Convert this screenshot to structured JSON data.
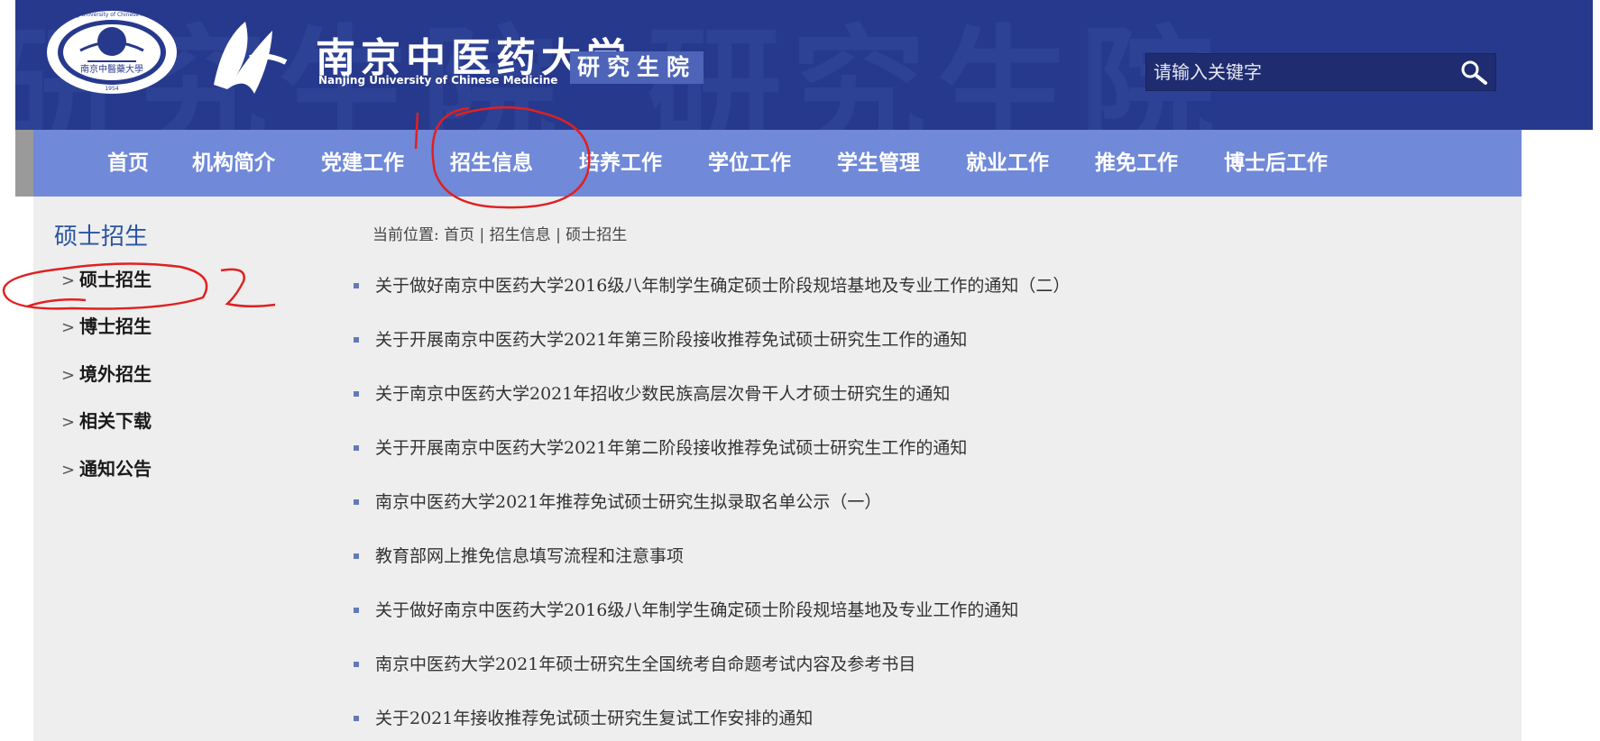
{
  "header": {
    "watermark_text": "研究生院",
    "emblem_text": "Nanjing University of Chinese Medicine",
    "emblem_cn": "南京中醫藥大學",
    "emblem_year": "1954",
    "univ_name": "南京中医药大学",
    "univ_name_en": "Nanjing University of Chinese Medicine",
    "dept_name": "研究生院",
    "search": {
      "placeholder": "请输入关键字"
    },
    "colors": {
      "header_bg": "#27398c",
      "nav_bg": "#7089d8",
      "accent": "#2a54a0"
    }
  },
  "nav": {
    "items": [
      {
        "label": "首页"
      },
      {
        "label": "机构简介"
      },
      {
        "label": "党建工作"
      },
      {
        "label": "招生信息"
      },
      {
        "label": "培养工作"
      },
      {
        "label": "学位工作"
      },
      {
        "label": "学生管理"
      },
      {
        "label": "就业工作"
      },
      {
        "label": "推免工作"
      },
      {
        "label": "博士后工作"
      }
    ]
  },
  "sidebar": {
    "title": "硕士招生",
    "items": [
      {
        "label": "硕士招生"
      },
      {
        "label": "博士招生"
      },
      {
        "label": "境外招生"
      },
      {
        "label": "相关下载"
      },
      {
        "label": "通知公告"
      }
    ],
    "chevron_icon": "chevron-right-icon"
  },
  "breadcrumb": {
    "text": "当前位置: 首页 | 招生信息 | 硕士招生"
  },
  "news": {
    "items": [
      {
        "title": "关于做好南京中医药大学2016级八年制学生确定硕士阶段规培基地及专业工作的通知（二）"
      },
      {
        "title": "关于开展南京中医药大学2021年第三阶段接收推荐免试硕士研究生工作的通知"
      },
      {
        "title": "关于南京中医药大学2021年招收少数民族高层次骨干人才硕士研究生的通知"
      },
      {
        "title": "关于开展南京中医药大学2021年第二阶段接收推荐免试硕士研究生工作的通知"
      },
      {
        "title": "南京中医药大学2021年推荐免试硕士研究生拟录取名单公示（一）"
      },
      {
        "title": "教育部网上推免信息填写流程和注意事项"
      },
      {
        "title": "关于做好南京中医药大学2016级八年制学生确定硕士阶段规培基地及专业工作的通知"
      },
      {
        "title": "南京中医药大学2021年硕士研究生全国统考自命题考试内容及参考书目"
      },
      {
        "title": "关于2021年接收推荐免试硕士研究生复试工作安排的通知"
      }
    ]
  },
  "annotations": {
    "mark_1": "1",
    "mark_2": "2",
    "color": "#e02020"
  }
}
